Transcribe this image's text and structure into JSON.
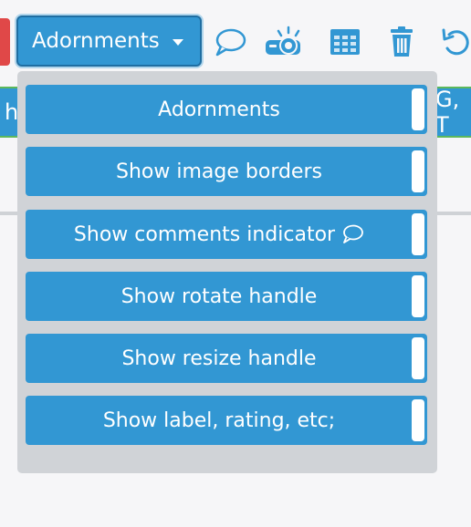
{
  "toolbar": {
    "dropdown_label": "Adornments",
    "icons": [
      "speech-bubble-icon",
      "projector-icon",
      "grid-icon",
      "trash-icon",
      "undo-icon"
    ]
  },
  "background": {
    "left_fragment": "h",
    "right_fragment": "G, T"
  },
  "menu": {
    "items": [
      {
        "label": "Adornments"
      },
      {
        "label": "Show image borders"
      },
      {
        "label": "Show comments indicator",
        "icon": "speech-bubble-icon"
      },
      {
        "label": "Show rotate handle"
      },
      {
        "label": "Show resize handle"
      },
      {
        "label": "Show label, rating, etc;"
      }
    ]
  },
  "colors": {
    "accent": "#3297d3",
    "menu_bg": "#d0d3d7",
    "red_tab": "#e04848",
    "green_border": "#5cb85c"
  }
}
